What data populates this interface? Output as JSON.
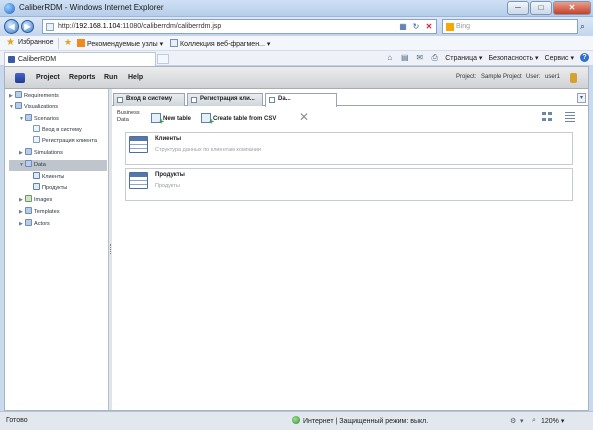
{
  "window": {
    "title": "CaliberRDM - Windows Internet Explorer",
    "minimize": "─",
    "maximize": "□",
    "close": "✕"
  },
  "browser": {
    "url_prefix": "http://",
    "url_host": "192.168.1.104",
    "url_rest": ":11080/caliberrdm/caliberrdm.jsp",
    "search_placeholder": "Bing",
    "favorites_label": "Избранное",
    "fav_item_1": "Рекомендуемые узлы ▾",
    "fav_item_2": "Коллекция веб-фрагмен... ▾",
    "tab_title": "CaliberRDM",
    "cmd_page": "Страница ▾",
    "cmd_safety": "Безопасность ▾",
    "cmd_service": "Сервис ▾",
    "cmd_help": "?"
  },
  "app": {
    "menu": [
      "Project",
      "Reports",
      "Run",
      "Help"
    ],
    "project_label": "Project:",
    "project_value": "Sample Project",
    "user_label": "User:",
    "user_value": "user1"
  },
  "tree": {
    "requirements": "Requirements",
    "visualizations": "Visualizations",
    "scenarios": "Scenarios",
    "scenario_1": "Вход в систему",
    "scenario_2": "Регистрация клиента",
    "simulations": "Simulations",
    "data": "Data",
    "data_1": "Клиенты",
    "data_2": "Продукты",
    "images": "Images",
    "templates": "Templates",
    "actors": "Actors"
  },
  "tabs": {
    "tab_1": "Вход в систему",
    "tab_2": "Регистрация кли...",
    "tab_3": "Da...",
    "dropdown": "▾"
  },
  "toolbar": {
    "business_line1": "Business",
    "business_line2": "Data",
    "new_table": "New table",
    "create_csv": "Create table from CSV",
    "delete": "✕"
  },
  "cards": [
    {
      "name": "Клиенты",
      "desc": "Структура данных по клиентам компании"
    },
    {
      "name": "Продукты",
      "desc": "Продукты"
    }
  ],
  "status": {
    "ready": "Готово",
    "zone": "Интернет | Защищенный режим: выкл.",
    "zoom": "120% ▾"
  }
}
